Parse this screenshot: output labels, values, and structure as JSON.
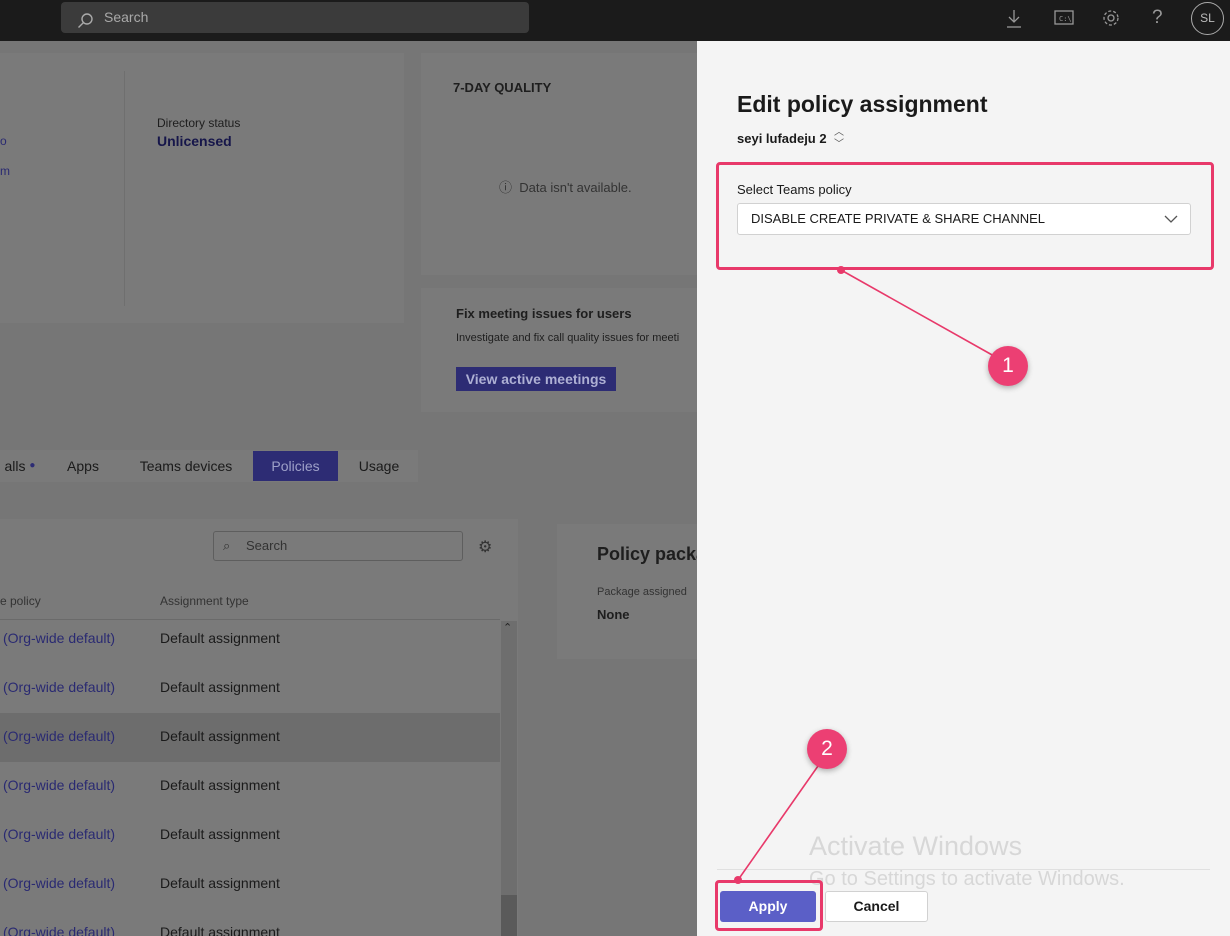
{
  "topbar": {
    "search_placeholder": "Search",
    "icons": [
      "download-icon",
      "terminal-icon",
      "gear-icon",
      "help-icon"
    ],
    "avatar_initials": "SL"
  },
  "background": {
    "directory_status_label": "Directory status",
    "directory_status_value": "Unlicensed",
    "left_fragment_1": "o",
    "left_fragment_2": "m",
    "quality_title": "7-DAY QUALITY",
    "quality_empty": "Data isn't available.",
    "fix_title": "Fix meeting issues for users",
    "fix_desc": "Investigate and fix call quality issues for meeti",
    "view_meetings_btn": "View active meetings",
    "tabs": [
      {
        "label": "alls"
      },
      {
        "label": "Apps"
      },
      {
        "label": "Teams devices"
      },
      {
        "label": "Policies"
      },
      {
        "label": "Usage"
      }
    ],
    "table_search_placeholder": "Search",
    "col_policy": "e policy",
    "col_assignment": "Assignment type",
    "rows": [
      {
        "policy": "(Org-wide default)",
        "assignment": "Default assignment"
      },
      {
        "policy": "(Org-wide default)",
        "assignment": "Default assignment"
      },
      {
        "policy": "(Org-wide default)",
        "assignment": "Default assignment"
      },
      {
        "policy": "(Org-wide default)",
        "assignment": "Default assignment"
      },
      {
        "policy": "(Org-wide default)",
        "assignment": "Default assignment"
      },
      {
        "policy": "(Org-wide default)",
        "assignment": "Default assignment"
      },
      {
        "policy": "(Org-wide default)",
        "assignment": "Default assignment"
      }
    ],
    "package_title": "Policy packa",
    "package_assigned_label": "Package assigned",
    "package_assigned_value": "None"
  },
  "panel": {
    "title": "Edit policy assignment",
    "user": "seyi lufadeju 2",
    "select_label": "Select Teams policy",
    "select_value": "DISABLE CREATE PRIVATE & SHARE CHANNEL",
    "apply_label": "Apply",
    "cancel_label": "Cancel"
  },
  "watermark": {
    "line1": "Activate Windows",
    "line2": "Go to Settings to activate Windows."
  },
  "annotations": {
    "badge1": "1",
    "badge2": "2",
    "color": "#e8396a"
  }
}
